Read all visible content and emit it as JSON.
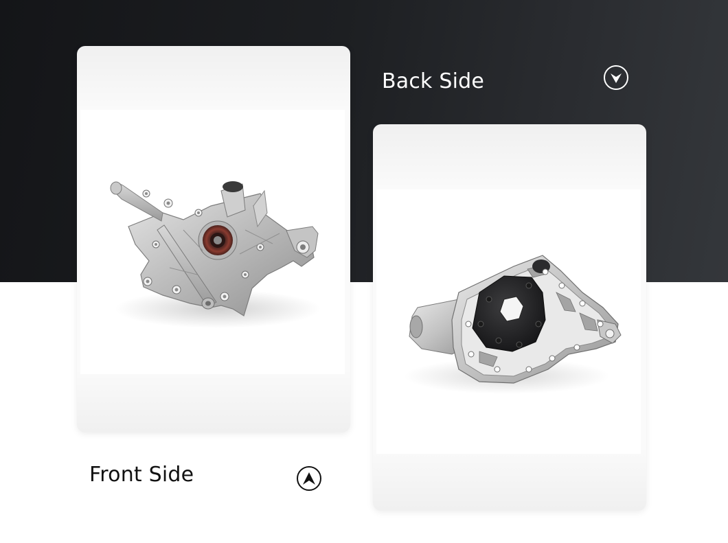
{
  "labels": {
    "front": "Front Side",
    "back": "Back Side"
  },
  "icons": {
    "back": "chevron-down-circle-icon",
    "front": "navigation-arrow-up-circle-icon"
  },
  "colors": {
    "band_dark": "#1d1f22",
    "card_bg": "#f0f0f0",
    "text_light": "#ffffff",
    "text_dark": "#111111"
  }
}
